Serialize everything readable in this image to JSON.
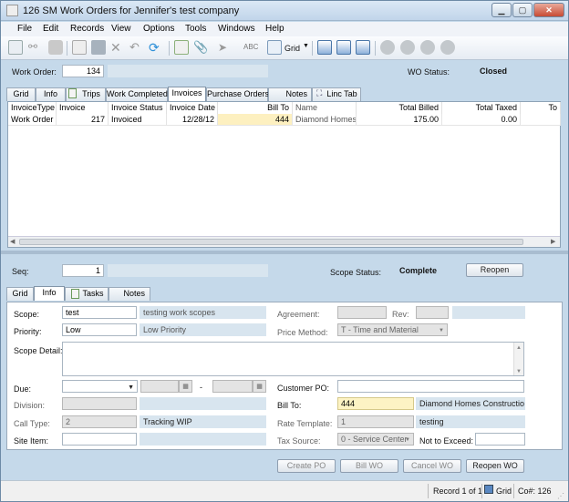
{
  "window": {
    "title": "126 SM Work Orders for Jennifer's test company"
  },
  "menu": [
    "File",
    "Edit",
    "Records",
    "View",
    "Options",
    "Tools",
    "Windows",
    "Help"
  ],
  "toolbar": {
    "grid_label": "Grid"
  },
  "header": {
    "work_order_label": "Work Order:",
    "work_order_value": "134",
    "wo_status_label": "WO Status:",
    "wo_status_value": "Closed"
  },
  "top_tabs": [
    "Grid",
    "Info",
    "Trips",
    "Work Completed",
    "Invoices",
    "Purchase Orders",
    "Notes",
    "Linc Tab"
  ],
  "invoices_grid": {
    "columns": [
      "InvoiceType",
      "Invoice",
      "Invoice Status",
      "Invoice Date",
      "Bill To",
      "Name",
      "Total Billed",
      "Total Taxed",
      "To"
    ],
    "rows": [
      {
        "type": "Work Order",
        "invoice": "217",
        "status": "Invoiced",
        "date": "12/28/12",
        "bill_to": "444",
        "name": "Diamond Homes C",
        "billed": "175.00",
        "taxed": "0.00"
      }
    ]
  },
  "scope": {
    "seq_label": "Seq:",
    "seq_value": "1",
    "status_label": "Scope Status:",
    "status_value": "Complete",
    "reopen_label": "Reopen"
  },
  "bottom_tabs": [
    "Grid",
    "Info",
    "Tasks",
    "Notes"
  ],
  "info": {
    "scope_label": "Scope:",
    "scope_value": "test",
    "scope_desc": "testing work scopes",
    "priority_label": "Priority:",
    "priority_value": "Low",
    "priority_desc": "Low Priority",
    "scope_detail_label": "Scope Detail:",
    "due_label": "Due:",
    "due_dash": "-",
    "division_label": "Division:",
    "call_type_label": "Call Type:",
    "call_type_value": "2",
    "call_type_desc": "Tracking WIP",
    "site_item_label": "Site Item:",
    "agreement_label": "Agreement:",
    "rev_label": "Rev:",
    "price_method_label": "Price Method:",
    "price_method_value": "T - Time and Material",
    "customer_po_label": "Customer PO:",
    "bill_to_label": "Bill To:",
    "bill_to_value": "444",
    "bill_to_name": "Diamond Homes Construction",
    "rate_template_label": "Rate Template:",
    "rate_template_value": "1",
    "rate_template_desc": "testing",
    "tax_source_label": "Tax Source:",
    "tax_source_value": "0 - Service Center",
    "not_to_exceed_label": "Not to Exceed:"
  },
  "actions": {
    "create_po": "Create PO",
    "bill_wo": "Bill WO",
    "cancel_wo": "Cancel WO",
    "reopen_wo": "Reopen WO"
  },
  "status": {
    "record": "Record 1 of 1",
    "grid": "Grid",
    "co": "Co#: 126"
  }
}
